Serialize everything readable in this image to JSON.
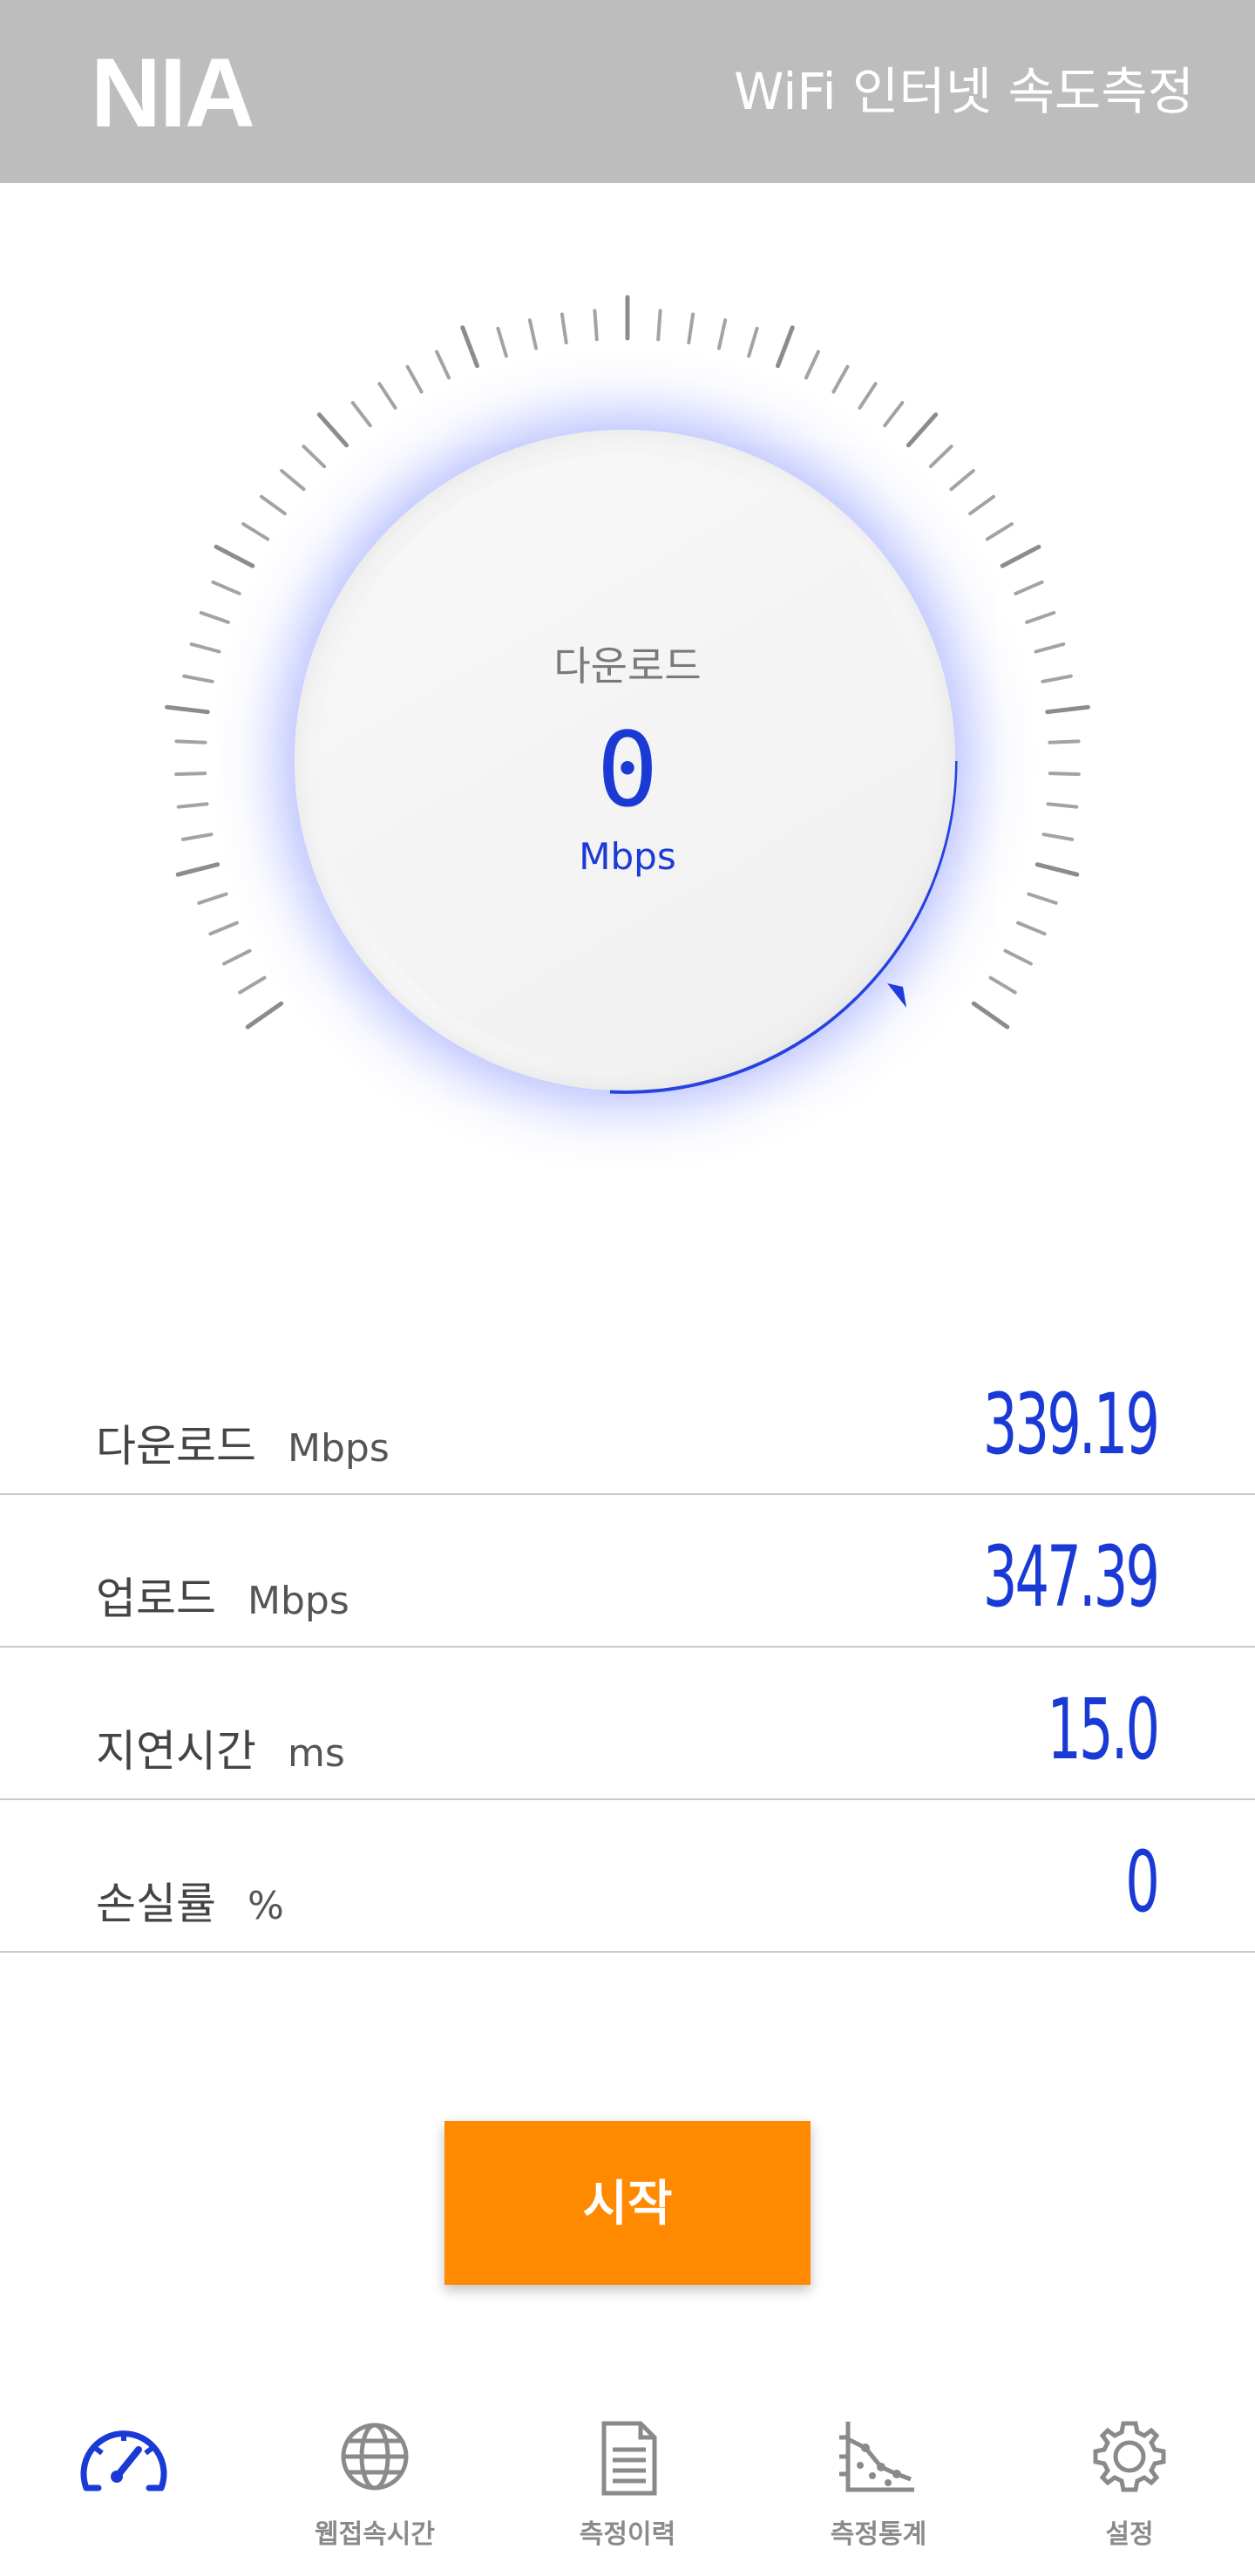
{
  "header": {
    "logo": "NIA",
    "title": "WiFi 인터넷 속도측정"
  },
  "gauge": {
    "label": "다운로드",
    "value": "0",
    "unit": "Mbps"
  },
  "results": [
    {
      "label": "다운로드",
      "unit": "Mbps",
      "value": "339.19"
    },
    {
      "label": "업로드",
      "unit": "Mbps",
      "value": "347.39"
    },
    {
      "label": "지연시간",
      "unit": "ms",
      "value": "15.0"
    },
    {
      "label": "손실률",
      "unit": "%",
      "value": "0"
    }
  ],
  "start_button": "시작",
  "nav": [
    {
      "icon": "speedometer-icon",
      "label": ""
    },
    {
      "icon": "globe-icon",
      "label": "웹접속시간"
    },
    {
      "icon": "document-icon",
      "label": "측정이력"
    },
    {
      "icon": "chart-icon",
      "label": "측정통계"
    },
    {
      "icon": "gear-icon",
      "label": "설정"
    }
  ],
  "colors": {
    "accent": "#1a3ad6",
    "start": "#ff8a00",
    "header": "#bdbdbd",
    "nav_active": "#1a3ad6",
    "nav_inactive": "#8a8a8a"
  }
}
